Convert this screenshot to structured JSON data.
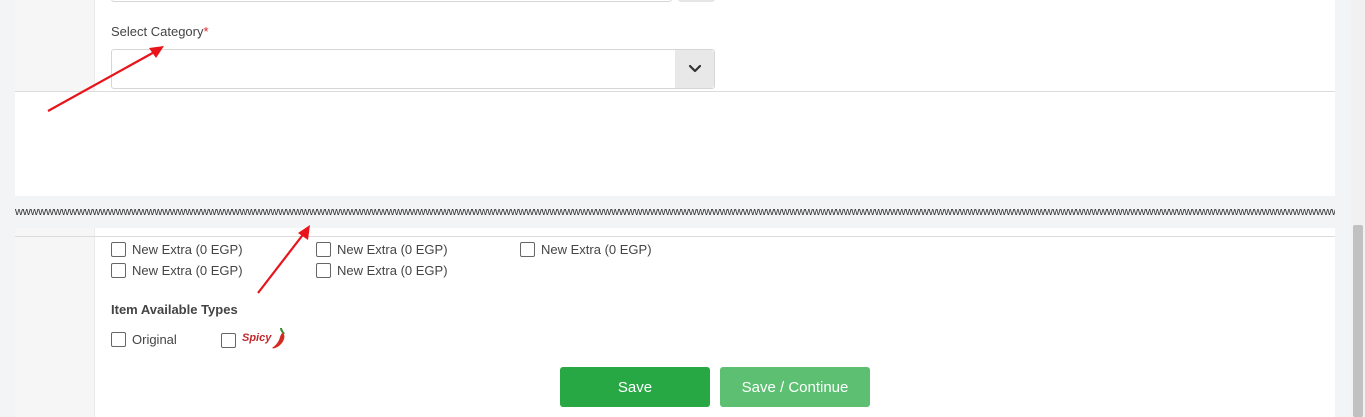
{
  "category": {
    "label": "Select Category",
    "required_mark": "*",
    "selected_value": ""
  },
  "extras_strip": "wwwwwwwwwwwwwwwwwwwwwwwwwwwwwwwwwwwwwwwwwwwwwwwwwwwwwwwwwwwwwwwwwwwwwwwwwwwwwwwwwwwwwwwwwwwwwwwwwwwwwwwwwwwwwwwwwwwwwwwwwwwwwwwwwwwwwwwwwwwwwwwwwwwwwwwwwwwwwwwwwwwwwwwwwwwwwwwwwwwwwwwwwwwwwwwwwwwwwwwwwwwwwwwwwwwwwwwwwwwwwwwww",
  "extras": [
    {
      "label": "New Extra (0 EGP)",
      "checked": false
    },
    {
      "label": "New Extra (0 EGP)",
      "checked": false
    },
    {
      "label": "New Extra (0 EGP)",
      "checked": false
    },
    {
      "label": "New Extra (0 EGP)",
      "checked": false
    },
    {
      "label": "New Extra (0 EGP)",
      "checked": false
    }
  ],
  "types": {
    "heading": "Item Available Types",
    "original_label": "Original",
    "spicy_label": "Spicy"
  },
  "buttons": {
    "save": "Save",
    "save_continue": "Save / Continue"
  },
  "colors": {
    "save": "#28a745",
    "save_continue": "#5cbf72",
    "annotation_arrow": "#e8141b",
    "required": "#d9232e"
  },
  "icons": {
    "dropdown": "chevron-down-icon",
    "spicy": "chili-pepper-icon"
  }
}
